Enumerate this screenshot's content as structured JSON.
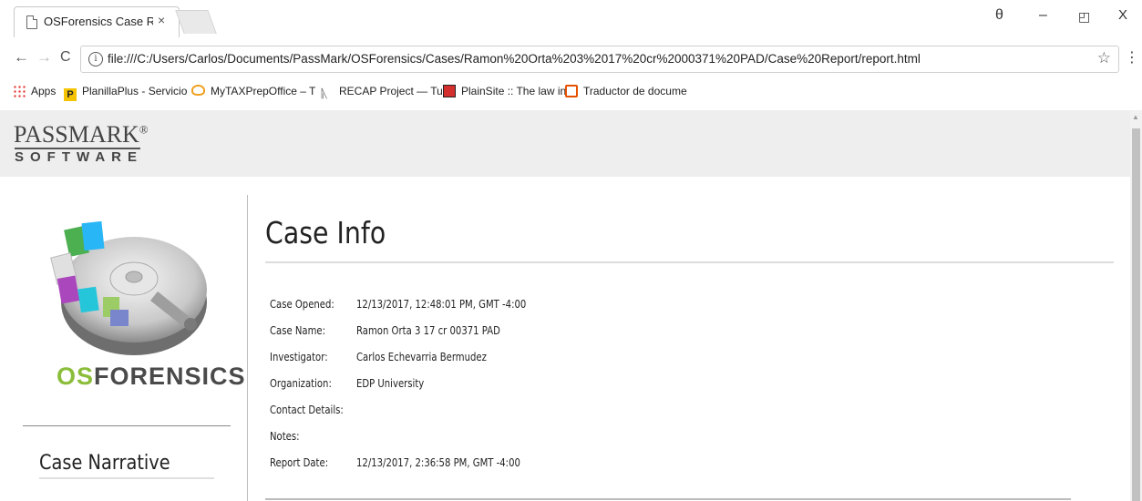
{
  "browser": {
    "tab_title": "OSForensics Case Report",
    "tab_close": "×",
    "url": "file:///C:/Users/Carlos/Documents/PassMark/OSForensics/Cases/Ramon%20Orta%203%2017%20cr%2000371%20PAD/Case%20Report/report.html",
    "window_buttons": {
      "account": "θ",
      "minimize": "–",
      "restore": "◰",
      "close": "X"
    },
    "nav": {
      "back": "←",
      "forward": "→",
      "reload": "C",
      "star": "☆",
      "menu": "⋮"
    },
    "bookmarks": [
      {
        "label": "Apps",
        "icon": "apps-grid-icon",
        "color": "#e53935"
      },
      {
        "label": "PlanillaPlus - Servicio",
        "icon": "planillaplus-icon",
        "color": "#f5c400"
      },
      {
        "label": "MyTAXPrepOffice – T",
        "icon": "cloud-icon",
        "color": "#f0a020"
      },
      {
        "label": "RECAP Project — Tur",
        "icon": "recap-icon",
        "color": "#333333"
      },
      {
        "label": "PlainSite :: The law in",
        "icon": "plainsite-icon",
        "color": "#d32f2f"
      },
      {
        "label": "Traductor de docume",
        "icon": "translator-icon",
        "color": "#e65100"
      }
    ]
  },
  "header": {
    "logo_top": "PASSMARK",
    "logo_reg": "®",
    "logo_bottom": "SOFTWARE"
  },
  "sidebar": {
    "product_logo": "OSFORENSICS",
    "narrative_link": "Case Narrative"
  },
  "main": {
    "title": "Case Info",
    "fields": [
      {
        "label": "Case Opened:",
        "value": "12/13/2017, 12:48:01 PM, GMT -4:00"
      },
      {
        "label": "Case Name:",
        "value": "Ramon Orta 3 17 cr 00371 PAD"
      },
      {
        "label": "Investigator:",
        "value": "Carlos Echevarria Bermudez"
      },
      {
        "label": "Organization:",
        "value": "EDP University"
      },
      {
        "label": "Contact Details:",
        "value": ""
      },
      {
        "label": "Notes:",
        "value": ""
      },
      {
        "label": "Report Date:",
        "value": "12/13/2017, 2:36:58 PM, GMT -4:00"
      }
    ]
  }
}
